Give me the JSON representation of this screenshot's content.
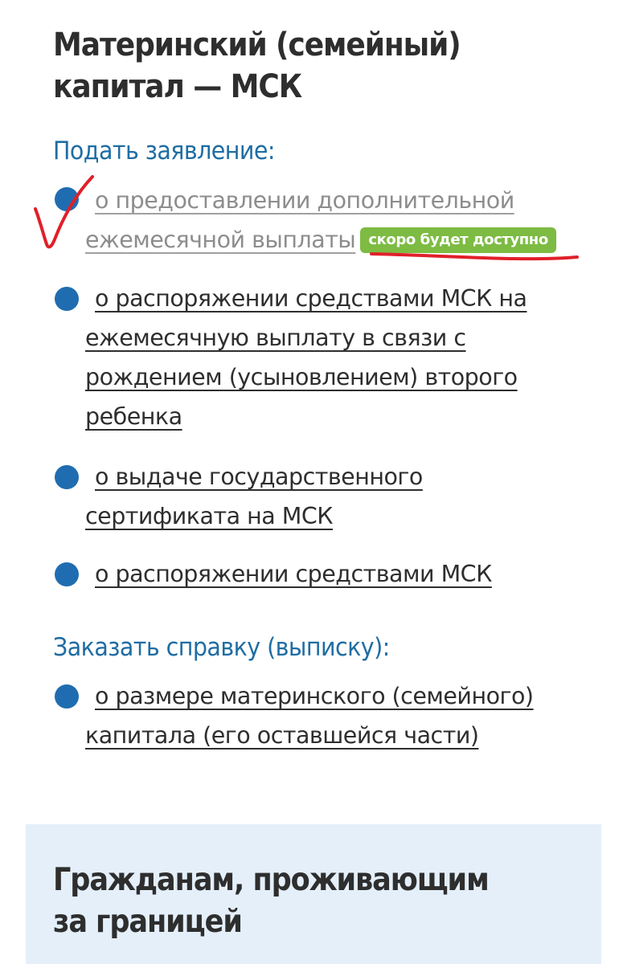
{
  "page": {
    "title": "Материнский (семейный) капитал — МСК"
  },
  "apply_section": {
    "title": "Подать заявление:",
    "items": [
      {
        "label": "о предоставлении дополнительной ежемесячной выплаты",
        "badge": "скоро будет доступно",
        "disabled": true
      },
      {
        "label": "о распоряжении средствами МСК на ежемесячную выплату в связи с рождением (усыновлением) второго ребенка"
      },
      {
        "label": "о выдаче государственного сертификата на МСК"
      },
      {
        "label": "о распоряжении средствами МСК"
      }
    ]
  },
  "order_section": {
    "title": "Заказать справку (выписку):",
    "items": [
      {
        "label": "о размере материнского (семейного) капитала (его оставшейся части)"
      }
    ]
  },
  "abroad_card": {
    "title": "Гражданам, проживающим за границей"
  },
  "colors": {
    "accent_blue": "#1f6da3",
    "bullet_blue": "#1f6db0",
    "badge_green": "#7dbb43",
    "annotation_red": "#e0202a",
    "card_background": "#e4effa"
  }
}
